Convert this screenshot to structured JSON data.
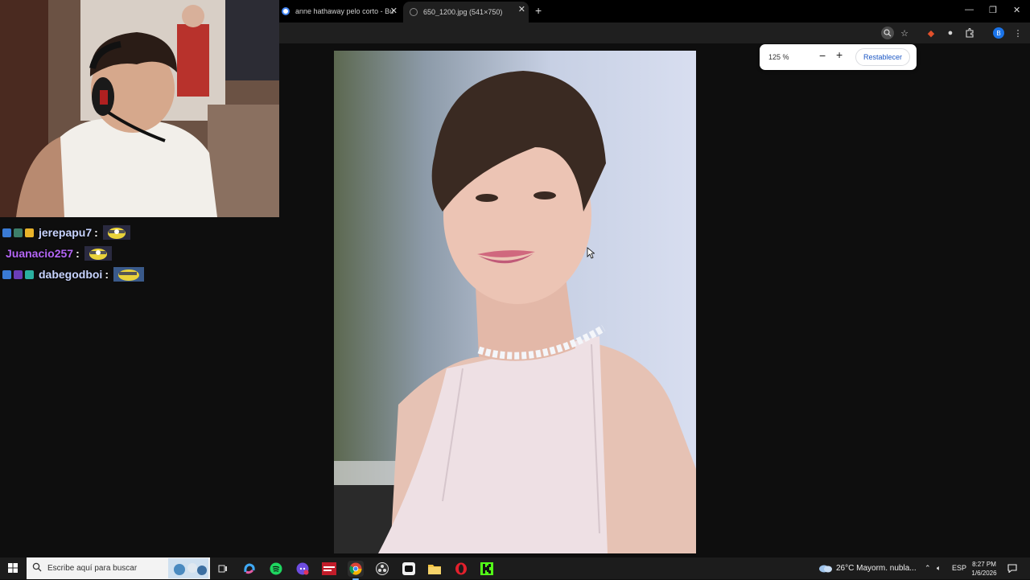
{
  "browser": {
    "tabs": [
      {
        "title": "anne hathaway pelo corto - Bu",
        "active": false
      },
      {
        "title": "650_1200.jpg (541×750)",
        "active": true
      }
    ],
    "new_tab_icon": "plus-icon",
    "window_controls": [
      "minimize-icon",
      "restore-icon",
      "close-icon"
    ]
  },
  "toolbar": {
    "icons": [
      "zoom-icon",
      "star-icon",
      "extension-red-icon",
      "extension-icon",
      "puzzle-icon",
      "profile-avatar",
      "menu-icon"
    ],
    "profile_initial": "B"
  },
  "zoom_popup": {
    "level": "125 %",
    "reset_label": "Restablecer"
  },
  "chat": {
    "messages": [
      {
        "user": "jerepapu7",
        "color": "#c8d4ff",
        "sep": ":"
      },
      {
        "user": "Juanacio257",
        "color": "#b466f5",
        "sep": ":"
      },
      {
        "user": "dabegodboi",
        "color": "#c8d4ff",
        "sep": ":"
      }
    ]
  },
  "taskbar": {
    "search_placeholder": "Escribe aquí para buscar",
    "weather": "26°C  Mayorm. nubla...",
    "language": "ESP",
    "time": "8:27 PM",
    "date": "1/6/2026"
  },
  "colors": {
    "accent": "#1a73e8",
    "reset_text": "#1a56c4",
    "taskbar_bg": "#1c1c1c"
  }
}
